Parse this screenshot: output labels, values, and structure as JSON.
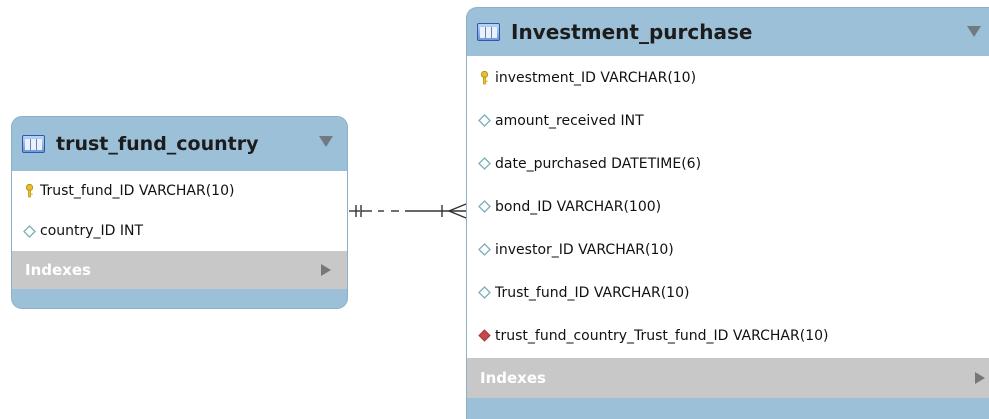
{
  "entities": [
    {
      "title": "trust_fund_country",
      "icon": "table-icon",
      "columns": [
        {
          "text": "Trust_fund_ID  VARCHAR(10)",
          "icon": "primary-key-icon"
        },
        {
          "text": "country_ID INT",
          "icon": "column-diamond-icon"
        }
      ],
      "indexes_label": "Indexes"
    },
    {
      "title": "Investment_purchase",
      "icon": "table-icon",
      "columns": [
        {
          "text": "investment_ID VARCHAR(10)",
          "icon": "primary-key-icon"
        },
        {
          "text": "amount_received INT",
          "icon": "column-diamond-icon"
        },
        {
          "text": "date_purchased DATETIME(6)",
          "icon": "column-diamond-icon"
        },
        {
          "text": "bond_ID VARCHAR(100)",
          "icon": "column-diamond-icon"
        },
        {
          "text": "investor_ID VARCHAR(10)",
          "icon": "column-diamond-icon"
        },
        {
          "text": "Trust_fund_ID  VARCHAR(10)",
          "icon": "column-diamond-icon"
        },
        {
          "text": "trust_fund_country_Trust_fund_ID  VARCHAR(10)",
          "icon": "foreign-key-icon"
        }
      ],
      "indexes_label": "Indexes"
    }
  ],
  "relationship": {
    "from": "trust_fund_country",
    "to": "Investment_purchase",
    "from_notation": "one-and-only-one",
    "to_notation": "one-or-many",
    "line_style": "dashed"
  },
  "colors": {
    "header": "#9dc0d9",
    "columns_bg": "#ffffff",
    "indexes_bg": "#c8c8c8",
    "key_yellow": "#e8c02a",
    "diamond_outline": "#7aaeb8",
    "foreign_key_red": "#c8474b"
  }
}
